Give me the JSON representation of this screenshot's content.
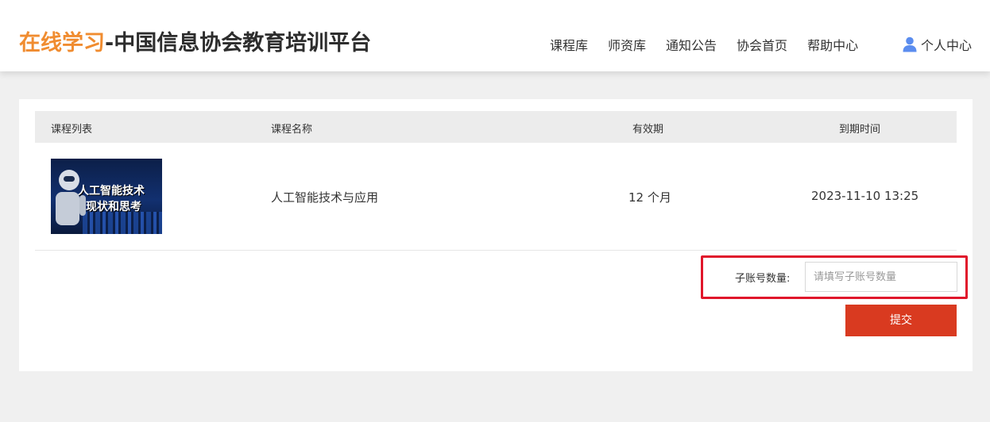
{
  "header": {
    "logo_highlight": "在线学习",
    "logo_rest": "-中国信息协会教育培训平台",
    "nav": [
      "课程库",
      "师资库",
      "通知公告",
      "协会首页",
      "帮助中心"
    ],
    "user_label": "个人中心"
  },
  "table": {
    "columns": [
      "课程列表",
      "课程名称",
      "有效期",
      "到期时间"
    ],
    "rows": [
      {
        "thumbnail_line1": "人工智能技术",
        "thumbnail_line2": "现状和思考",
        "name": "人工智能技术与应用",
        "validity": "12 个月",
        "expiry": "2023-11-10 13:25"
      }
    ]
  },
  "form": {
    "sub_account_label": "子账号数量:",
    "sub_account_placeholder": "请填写子账号数量",
    "sub_account_value": ""
  },
  "submit_label": "提交",
  "colors": {
    "logo_orange": "#f08c30",
    "submit_red": "#d93a20",
    "highlight_red": "#e0162b"
  }
}
